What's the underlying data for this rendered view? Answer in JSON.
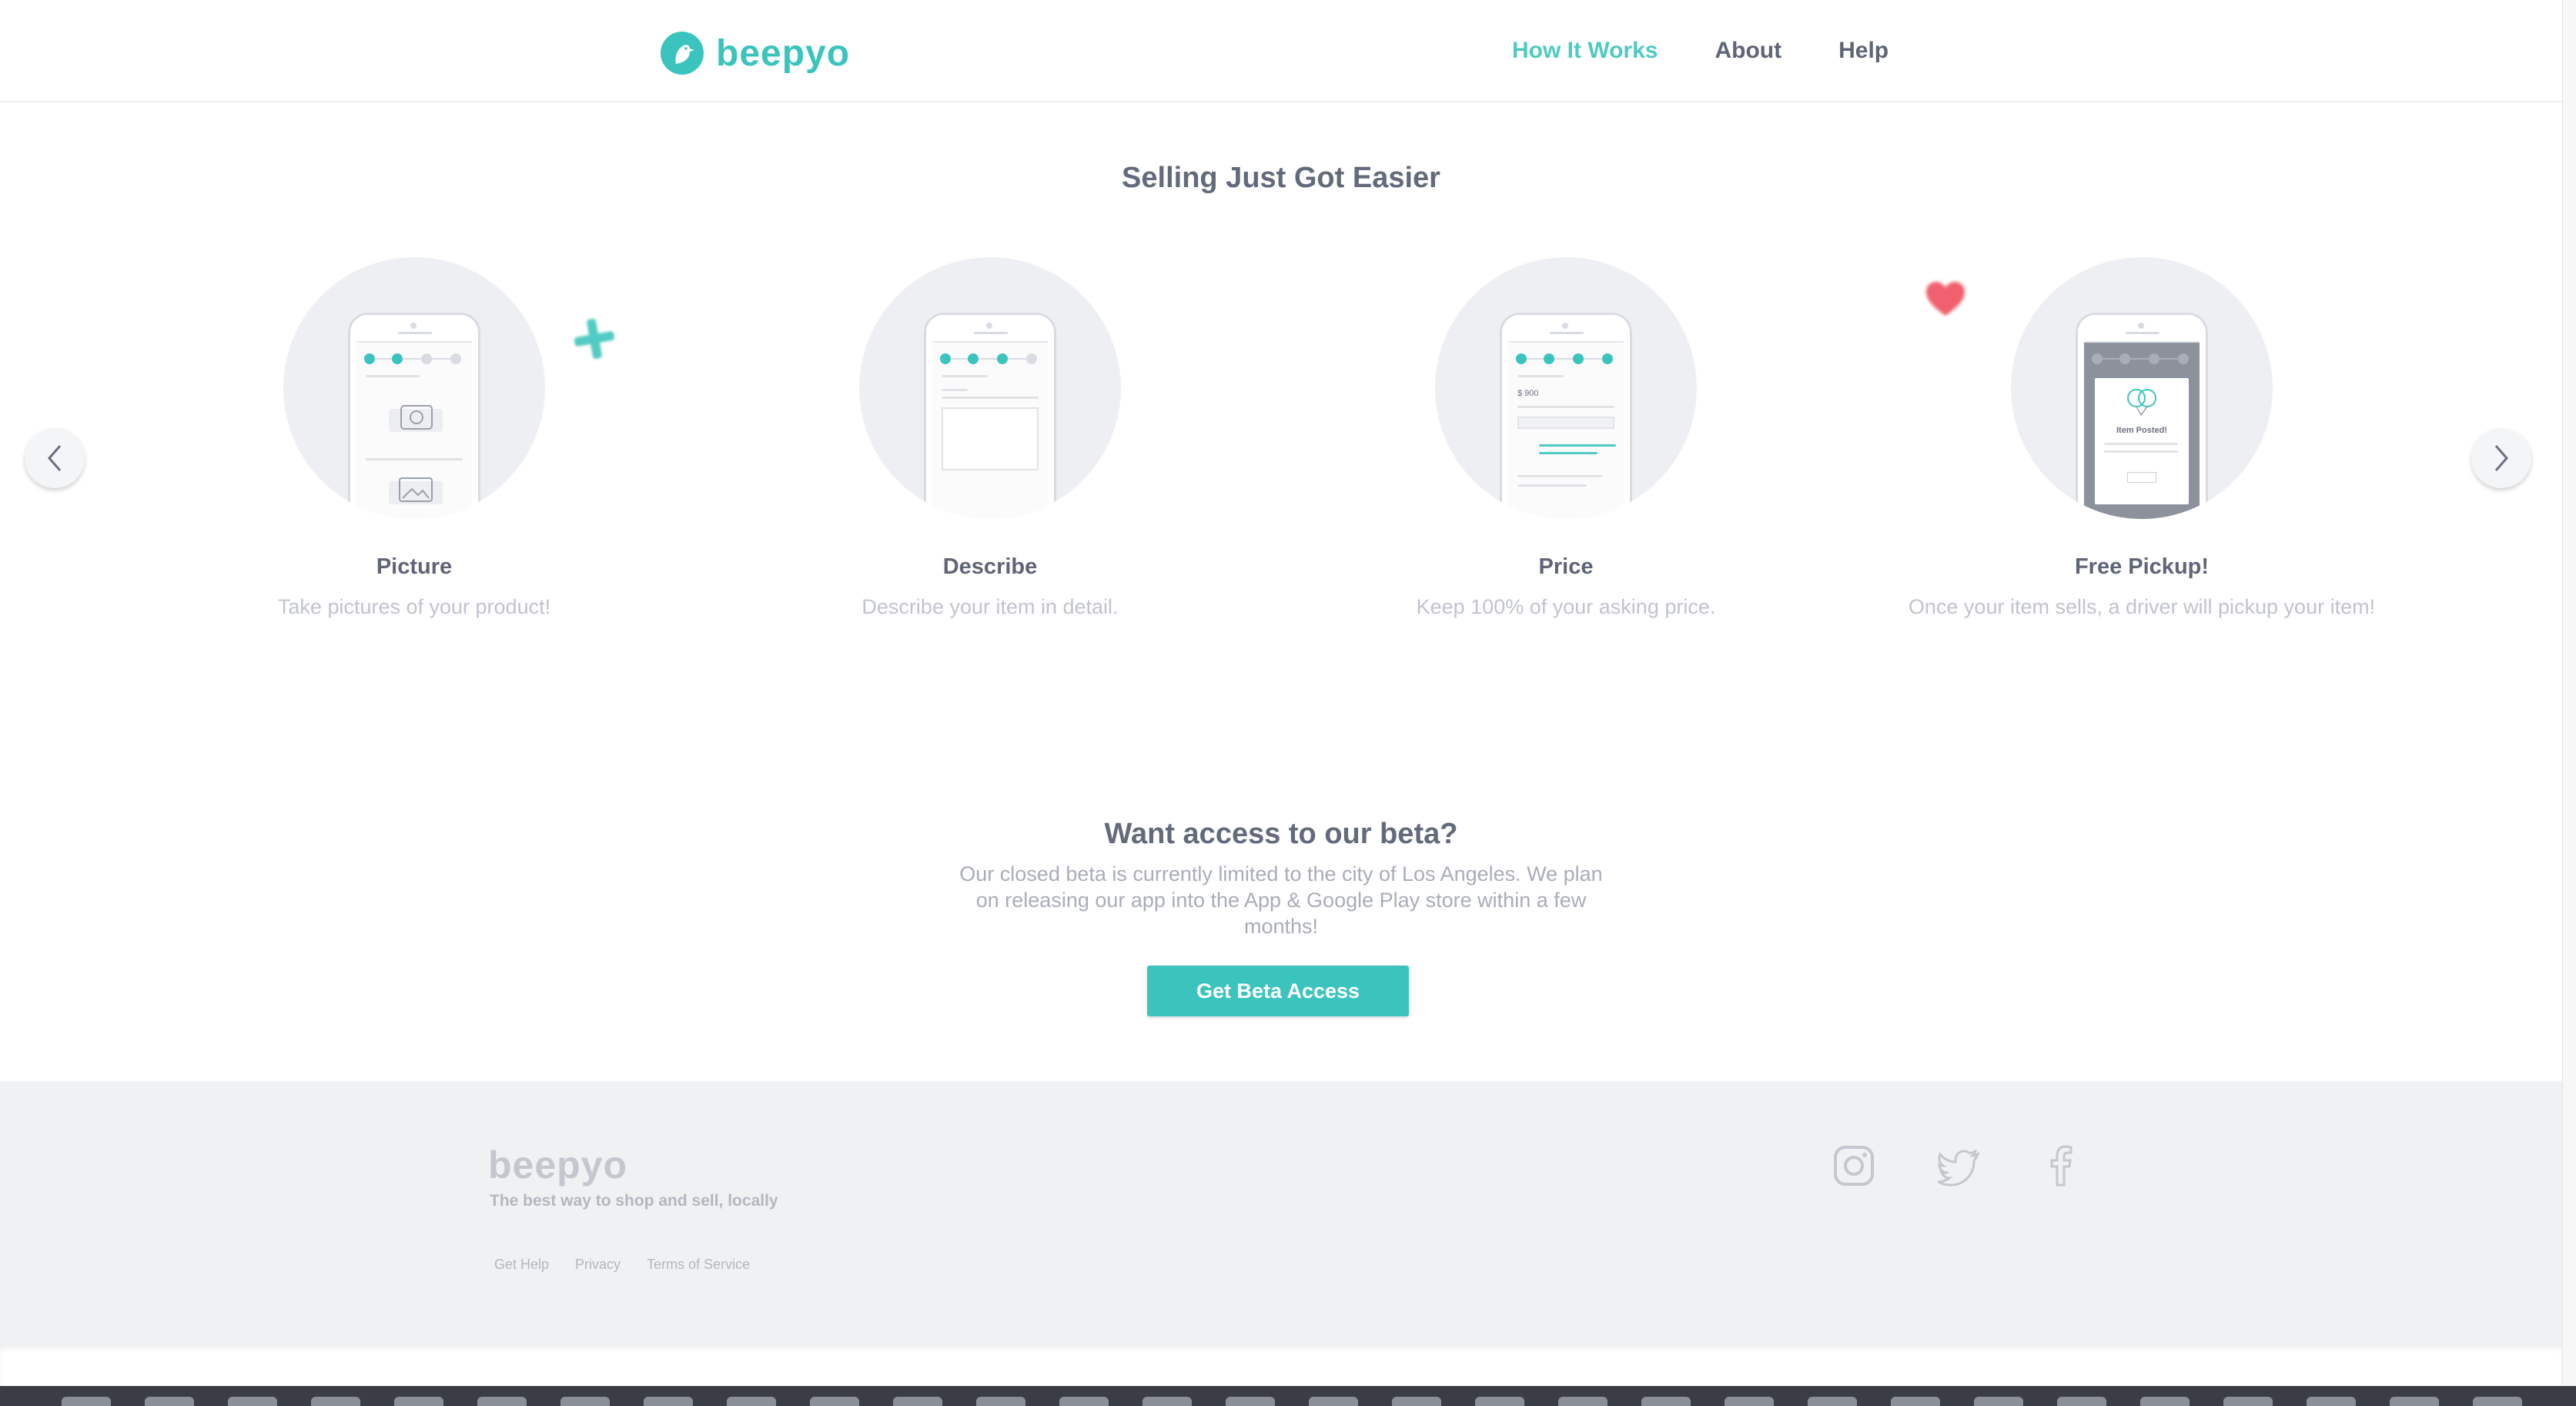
{
  "brand": {
    "name": "beepyo",
    "accent": "#3bc4bd"
  },
  "nav": {
    "items": [
      "How It Works",
      "About",
      "Help"
    ],
    "active": "How It Works"
  },
  "how_it_works": {
    "title": "Selling Just Got Easier",
    "steps": [
      {
        "title": "Picture",
        "description": "Take pictures of your product!"
      },
      {
        "title": "Describe",
        "description": "Describe your item in detail."
      },
      {
        "title": "Price",
        "description": "Keep 100% of your asking price.",
        "price_text": "$ 900"
      },
      {
        "title": "Free Pickup!",
        "description": "Once your item sells, a driver will pickup your item!",
        "screen_text": "Item Posted!"
      }
    ],
    "prev_icon": "chevron-left-icon",
    "next_icon": "chevron-right-icon"
  },
  "beta": {
    "title": "Want access to our beta?",
    "text": "Our closed beta is currently limited to the city of Los Angeles. We plan on releasing our app into the App & Google Play store within a few months!",
    "button_label": "Get Beta Access"
  },
  "footer": {
    "logo": "beepyo",
    "tagline": "The best way to shop and sell, locally",
    "links": [
      "Get Help",
      "Privacy",
      "Terms of Service"
    ],
    "social": [
      "instagram-icon",
      "twitter-icon",
      "facebook-icon"
    ]
  }
}
